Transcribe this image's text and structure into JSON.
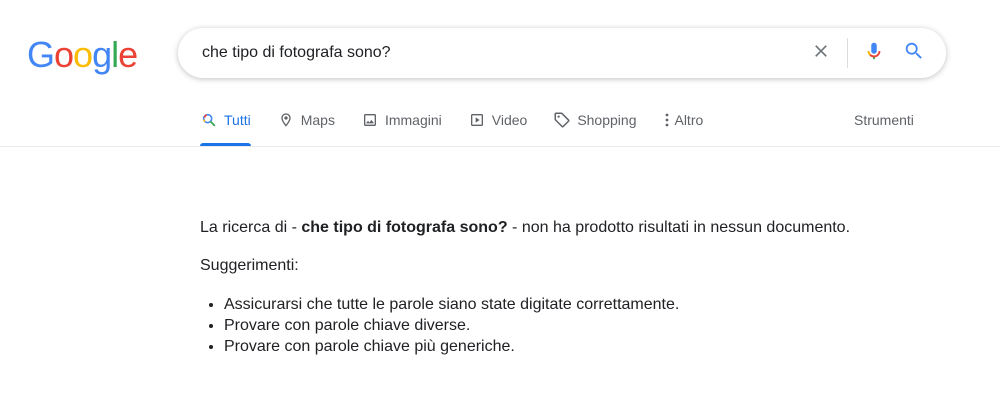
{
  "logo": {
    "text": "Google",
    "letters": [
      "G",
      "o",
      "o",
      "g",
      "l",
      "e"
    ]
  },
  "search": {
    "query": "che tipo di fotografa sono?",
    "clear_icon": "close-icon",
    "voice_icon": "microphone-icon",
    "search_icon": "search-icon"
  },
  "tabs": [
    {
      "label": "Tutti",
      "icon": "search-icon",
      "active": true
    },
    {
      "label": "Maps",
      "icon": "map-pin-icon"
    },
    {
      "label": "Immagini",
      "icon": "image-icon"
    },
    {
      "label": "Video",
      "icon": "play-icon"
    },
    {
      "label": "Shopping",
      "icon": "tag-icon"
    },
    {
      "label": "Altro",
      "icon": "more-vertical-icon"
    }
  ],
  "tools_label": "Strumenti",
  "result": {
    "prefix": "La ricerca di - ",
    "query": "che tipo di fotografa sono?",
    "suffix": " - non ha prodotto risultati in nessun documento.",
    "suggestions_title": "Suggerimenti:",
    "suggestions": [
      "Assicurarsi che tutte le parole siano state digitate correttamente.",
      "Provare con parole chiave diverse.",
      "Provare con parole chiave più generiche."
    ]
  },
  "colors": {
    "accent": "#1a73e8",
    "google_blue": "#4285f4",
    "google_red": "#ea4335",
    "google_yellow": "#fbbc05",
    "google_green": "#34a853",
    "tab_text": "#5f6368"
  }
}
